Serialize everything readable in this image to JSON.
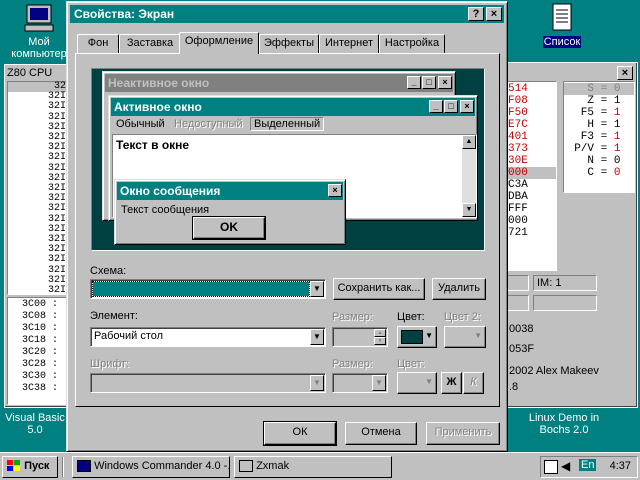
{
  "desktop": {
    "icons": [
      {
        "label": "Мой компьютер"
      },
      {
        "label": "Список"
      },
      {
        "label": "Visual Basic 5.0"
      },
      {
        "label": "Linux Demo in Bochs 2.0"
      }
    ]
  },
  "zxmak_left": {
    "title": "Z80 CPU",
    "rows": [
      "32",
      "32I",
      "32I",
      "32I",
      "32I",
      "32I",
      "32I",
      "32I",
      "32I",
      "32I",
      "32I",
      "32I",
      "32I",
      "32I",
      "32I",
      "32I",
      "32I",
      "32I",
      "32I",
      "32I",
      "32I"
    ],
    "mem_rows": [
      "3C00 :",
      "3C08 :",
      "3C10 :",
      "3C18 :",
      "3C20 :",
      "3C28 :",
      "3C30 :",
      "3C38 :"
    ]
  },
  "zxmak_right": {
    "hex_col": [
      "514",
      "F08",
      "F50",
      "E7C",
      "401",
      "373",
      "30E",
      "000",
      "C3A",
      "DBA",
      "FFF",
      "000",
      "721"
    ],
    "flags": [
      {
        "name": "S",
        "value": "0"
      },
      {
        "name": "Z",
        "value": "1"
      },
      {
        "name": "F5",
        "value": "1"
      },
      {
        "name": "H",
        "value": "1"
      },
      {
        "name": "F3",
        "value": "1"
      },
      {
        "name": "P/V",
        "value": "1"
      },
      {
        "name": "N",
        "value": "0"
      },
      {
        "name": "C",
        "value": "0"
      }
    ],
    "im_label": "IM: 1",
    "addr1": "0038",
    "addr2": "053F",
    "credit": "2002 Alex Makeev",
    "credit2": ".8"
  },
  "dialog": {
    "title": "Свойства: Экран",
    "help_btn": "?",
    "close_btn": "×",
    "tabs": [
      "Фон",
      "Заставка",
      "Оформление",
      "Эффекты",
      "Интернет",
      "Настройка"
    ],
    "active_tab": 2,
    "preview": {
      "inactive_title": "Неактивное окно",
      "active_title": "Активное окно",
      "menu": [
        "Обычный",
        "Недоступный",
        "Выделенный"
      ],
      "window_text": "Текст в окне",
      "msg_title": "Окно сообщения",
      "msg_text": "Текст сообщения",
      "msg_ok": "OK"
    },
    "scheme_label": "Схема:",
    "scheme_value": "",
    "save_as": "Сохранить как...",
    "delete": "Удалить",
    "element_label": "Элемент:",
    "element_value": "Рабочий стол",
    "size_label": "Размер:",
    "color_label": "Цвет:",
    "color2_label": "Цвет 2:",
    "font_label": "Шрифт:",
    "font_size_label": "Размер:",
    "font_color_label": "Цвет:",
    "bold_btn": "Ж",
    "italic_btn": "К",
    "ok": "ОК",
    "cancel": "Отмена",
    "apply": "Применить",
    "color_value": "#004040"
  },
  "taskbar": {
    "start": "Пуск",
    "items": [
      "Windows Commander 4.0 -...",
      "Zxmak"
    ],
    "lang": "En",
    "time": "4:37"
  }
}
